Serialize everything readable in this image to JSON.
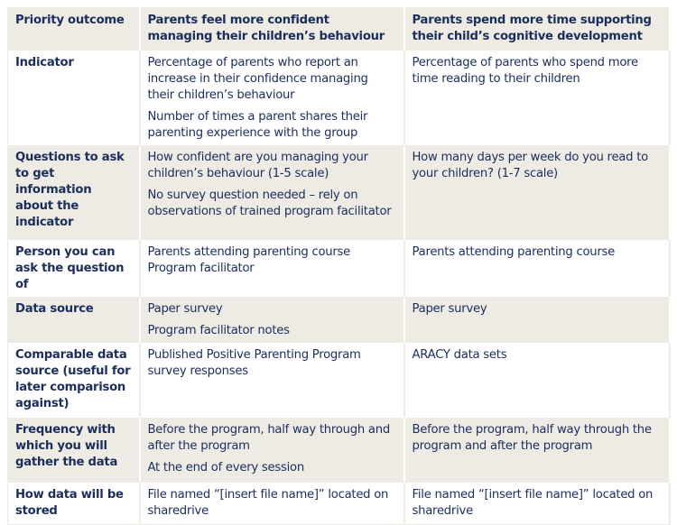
{
  "header": {
    "label": "Priority outcome",
    "outcomes": [
      "Parents feel more confident managing their children’s behaviour",
      "Parents spend more time supporting their child’s cognitive development"
    ]
  },
  "rows": [
    {
      "label": "Indicator",
      "col1": [
        "Percentage of parents who report an increase in their confidence managing their children’s behaviour",
        "Number of times a parent shares their parenting experience with the group"
      ],
      "col2": [
        "Percentage of parents who spend more time reading to their children"
      ]
    },
    {
      "label": "Questions to ask to get information about the indicator",
      "col1": [
        "How confident are you managing your children’s behaviour (1-5 scale)",
        "No survey question needed – rely on observations of trained program facilitator"
      ],
      "col2": [
        "How many days per week do you read to your children? (1-7 scale)"
      ]
    },
    {
      "label": "Person you can ask the question of",
      "col1": [
        "Parents attending parenting course Program facilitator"
      ],
      "col2": [
        "Parents attending parenting course"
      ]
    },
    {
      "label": "Data source",
      "col1": [
        "Paper survey",
        "Program facilitator notes"
      ],
      "col2": [
        "Paper survey"
      ]
    },
    {
      "label": "Comparable data source (useful for later comparison against)",
      "col1": [
        "Published Positive Parenting Program survey responses"
      ],
      "col2": [
        "ARACY data sets"
      ]
    },
    {
      "label": "Frequency with which you will gather the data",
      "col1": [
        "Before the program, half way through and after the program",
        "At the end of every session"
      ],
      "col2": [
        "Before the program, half way through the program and after the program"
      ]
    },
    {
      "label": "How data will be stored",
      "col1": [
        "File named “[insert file name]” located on sharedrive"
      ],
      "col2": [
        "File named “[insert file name]” located on sharedrive"
      ]
    }
  ],
  "colors": {
    "text": "#1b2e5c",
    "shade": "#eeebe5",
    "plain": "#ffffff"
  }
}
